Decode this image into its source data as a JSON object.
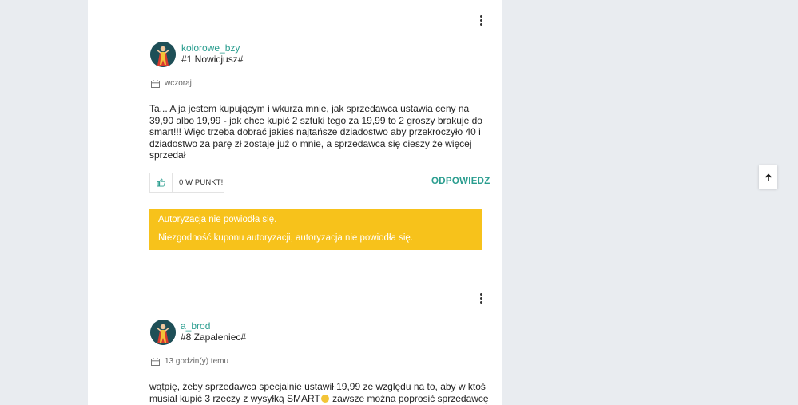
{
  "posts": [
    {
      "username": "kolorowe_bzy",
      "rank": "#1 Nowicjusz#",
      "date": "wczoraj",
      "body": "Ta... A ja jestem kupującym i wkurza mnie, jak sprzedawca ustawia ceny na 39,90 albo 19,99 - jak chce kupić 2 sztuki tego za 19,99 to 2 groszy brakuje do smart!!! Więc trzeba dobrać jakieś najtańsze dziadostwo aby przekroczyło 40 i dziadostwo za parę  zł zostaje już o mnie, a sprzedawca się cieszy że więcej sprzedał",
      "kudos_label": "0 W PUNKT!",
      "reply_label": "ODPOWIEDZ",
      "avatar_icon": "superhero-avatar-icon"
    },
    {
      "username": "a_brod",
      "rank": "#8 Zapaleniec#",
      "date": "13 godzin(y) temu",
      "body_part1": "wątpię, żeby sprzedawca specjalnie ustawił 19,99 ze względu na to, aby w ktoś musiał kupić 3 rzeczy z wysyłką SMART",
      "body_part2": " zawsze można poprosić sprzedawcę aby specjalnie",
      "emoji_icon": "smiley-emoji-icon",
      "avatar_icon": "superhero-avatar-icon"
    }
  ],
  "alert": {
    "line1": "Autoryzacja nie powiodła się.",
    "line2": "Niezgodność kuponu autoryzacji, autoryzacja nie powiodła się.",
    "color": "#f7c21b"
  },
  "colors": {
    "accent": "#2a9d8f",
    "background": "#e9ecf0",
    "panel": "#ffffff"
  },
  "icons": {
    "menu": "kebab-menu-icon",
    "calendar": "calendar-icon",
    "thumbs_up": "thumbs-up-icon",
    "back_to_top": "arrow-up-icon"
  }
}
